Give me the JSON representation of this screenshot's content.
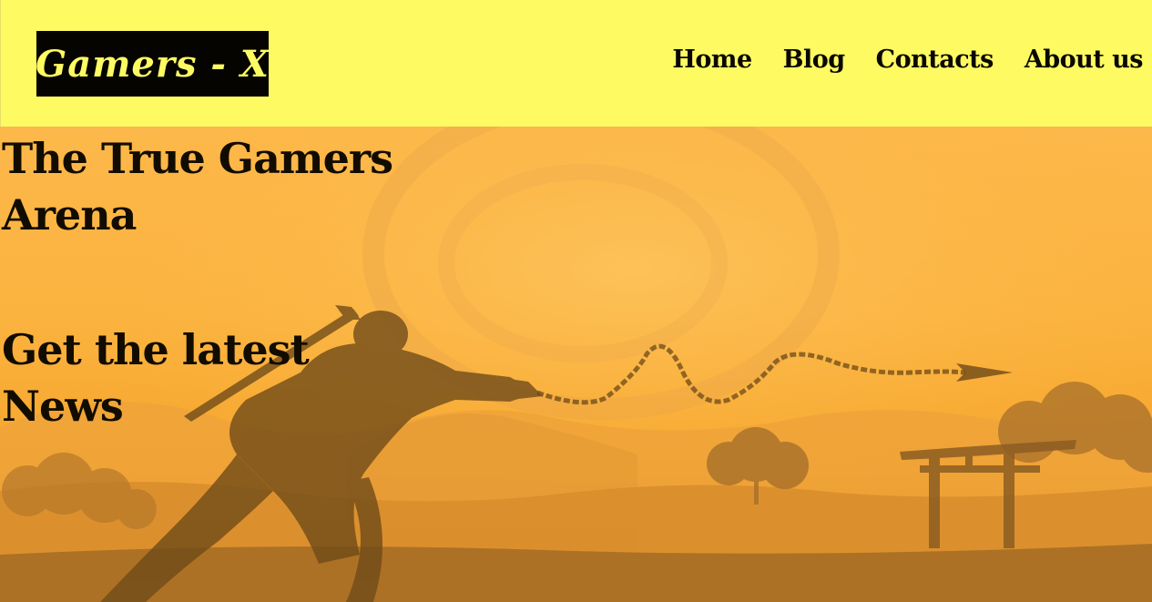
{
  "header": {
    "logo_text": "Gamers - X",
    "nav": [
      "Home",
      "Blog",
      "Contacts",
      "About us"
    ]
  },
  "hero": {
    "title": "The True Gamers Arena",
    "subtitle": "Get the latest News"
  },
  "colors": {
    "header_bg": "#fefa62",
    "logo_bg": "#050400",
    "hero_bg": "#fbb33f",
    "text": "#120c00"
  }
}
